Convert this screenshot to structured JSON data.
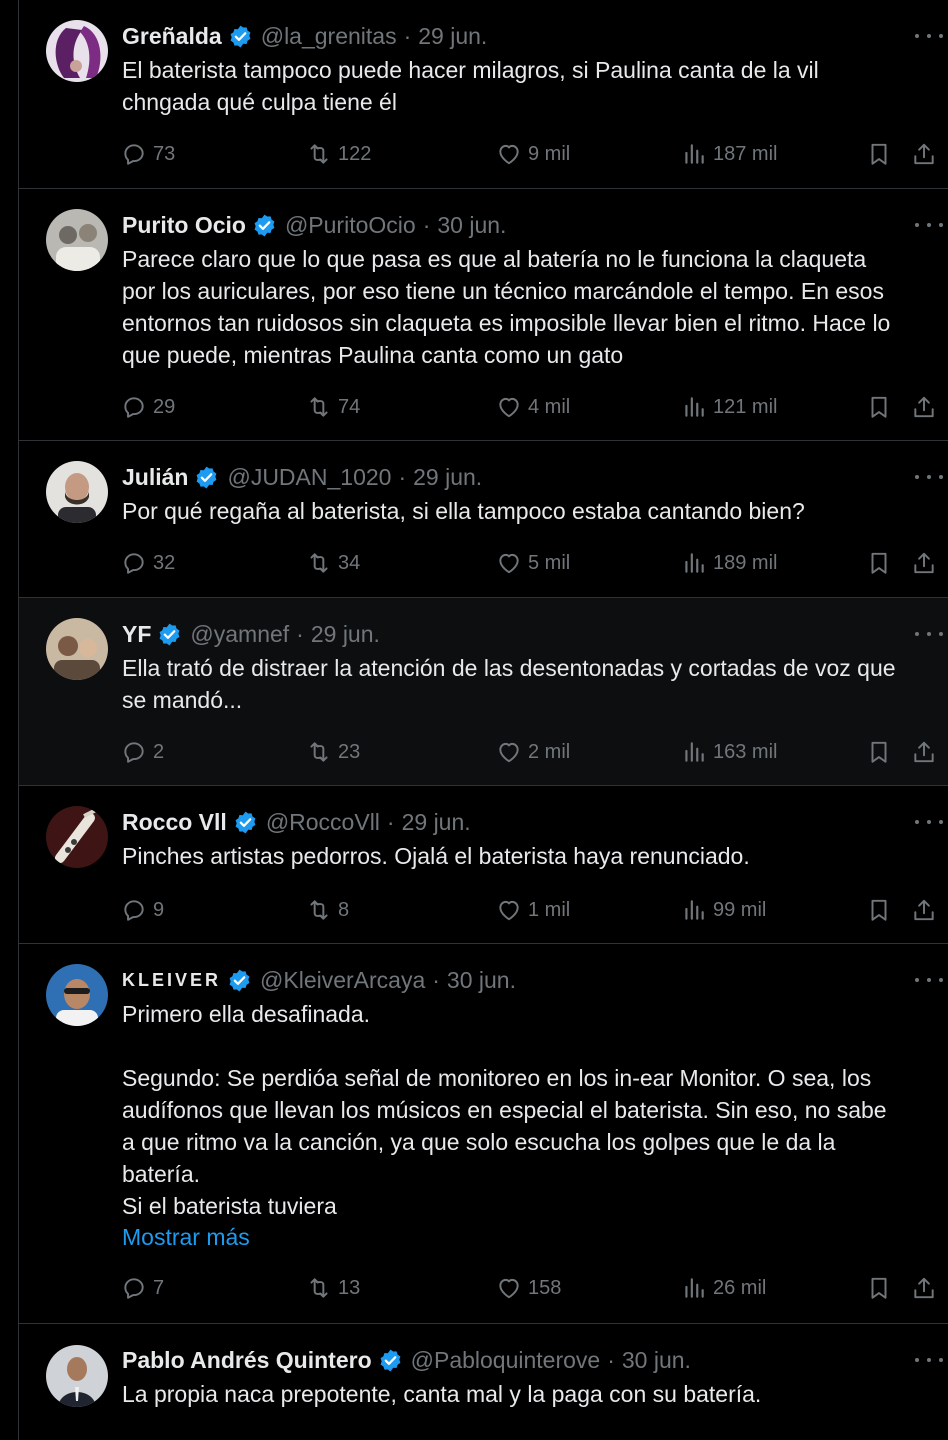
{
  "tweets": [
    {
      "name": "Greñalda",
      "handle": "@la_grenitas",
      "date": "29 jun.",
      "text": "El baterista tampoco puede hacer milagros, si Paulina canta de la vil\nchngada qué culpa tiene él",
      "replies": "73",
      "retweets": "122",
      "likes": "9 mil",
      "views": "187 mil",
      "avatar_color": "#6b2a6e"
    },
    {
      "name": "Purito Ocio",
      "handle": "@PuritoOcio",
      "date": "30 jun.",
      "text": "Parece claro que lo que pasa es que al batería no le funciona la claqueta\npor los auriculares, por eso tiene un técnico marcándole el tempo. En esos\nentornos tan ruidosos sin claqueta es imposible llevar bien el ritmo. Hace lo\nque puede, mientras Paulina canta como un gato",
      "replies": "29",
      "retweets": "74",
      "likes": "4 mil",
      "views": "121 mil",
      "avatar_color": "#9a9a94"
    },
    {
      "name": "Julián",
      "handle": "@JUDAN_1020",
      "date": "29 jun.",
      "text": "Por qué regaña al baterista, si ella tampoco estaba cantando bien?",
      "replies": "32",
      "retweets": "34",
      "likes": "5 mil",
      "views": "189 mil",
      "avatar_color": "#d9d6d0"
    },
    {
      "name": "YF",
      "handle": "@yamnef",
      "date": "29 jun.",
      "text": "Ella trató de distraer la atención de las desentonadas y cortadas de voz que\nse mandó...",
      "replies": "2",
      "retweets": "23",
      "likes": "2 mil",
      "views": "163 mil",
      "avatar_color": "#8a6a4e"
    },
    {
      "name": "Rocco Vll",
      "handle": "@RoccoVll",
      "date": "29 jun.",
      "text": "Pinches artistas pedorros. Ojalá el baterista haya renunciado.",
      "replies": "9",
      "retweets": "8",
      "likes": "1 mil",
      "views": "99 mil",
      "avatar_color": "#5a1c1c"
    },
    {
      "name": "KLEIVER",
      "handle": "@KleiverArcaya",
      "date": "30 jun.",
      "text": "Primero ella desafinada.\n\nSegundo: Se perdióa señal de monitoreo en los in-ear Monitor. O sea, los\naudífonos que llevan los músicos en especial el baterista. Sin eso, no sabe\na que ritmo va la canción, ya que solo escucha los golpes que le da la\nbatería.\nSi el baterista tuviera",
      "show_more": "Mostrar más",
      "replies": "7",
      "retweets": "13",
      "likes": "158",
      "views": "26 mil",
      "avatar_color": "#2f6fb3"
    },
    {
      "name": "Pablo Andrés Quintero",
      "handle": "@Pabloquinterove",
      "date": "30 jun.",
      "text": "La propia naca prepotente, canta mal y la paga con su batería.",
      "avatar_color": "#cfd2d6"
    }
  ],
  "icons": {
    "verified": "verified-badge-icon",
    "reply": "reply-icon",
    "retweet": "retweet-icon",
    "like": "heart-icon",
    "views": "views-icon",
    "bookmark": "bookmark-icon",
    "share": "share-icon",
    "more": "more-icon"
  },
  "colors": {
    "background": "#000000",
    "text": "#e7e9ea",
    "muted": "#71767b",
    "link": "#1d9bf0",
    "verified": "#1d9bf0",
    "border": "#2f3336"
  }
}
